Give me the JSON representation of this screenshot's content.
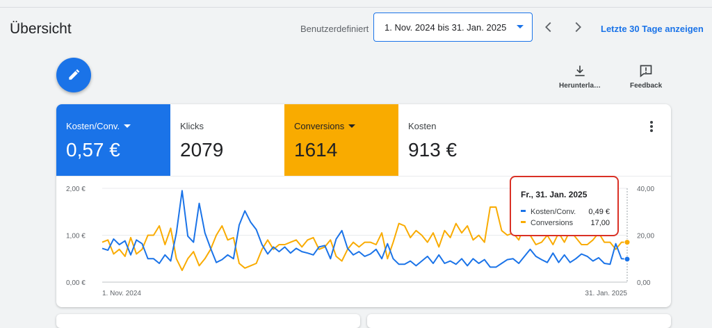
{
  "page": {
    "title": "Übersicht"
  },
  "date_range": {
    "label": "Benutzerdefiniert",
    "value": "1. Nov. 2024 bis 31. Jan. 2025",
    "prev_icon": "chevron-left-icon",
    "next_icon": "chevron-right-icon",
    "last_days_link": "Letzte 30 Tage anzeigen"
  },
  "toolbar": {
    "edit_icon": "pencil-icon",
    "download_label": "Herunterla…",
    "feedback_label": "Feedback"
  },
  "metrics": [
    {
      "name": "Kosten/Conv.",
      "value": "0,57 €",
      "selected": true,
      "color": "#1a73e8"
    },
    {
      "name": "Klicks",
      "value": "2079",
      "selected": false
    },
    {
      "name": "Conversions",
      "value": "1614",
      "selected": true,
      "color": "#f9ab00"
    },
    {
      "name": "Kosten",
      "value": "913 €",
      "selected": false
    }
  ],
  "tooltip": {
    "title": "Fr., 31. Jan. 2025",
    "rows": [
      {
        "label": "Kosten/Conv.",
        "value": "0,49 €",
        "color": "#1a73e8"
      },
      {
        "label": "Conversions",
        "value": "17,00",
        "color": "#f9ab00"
      }
    ]
  },
  "chart_data": {
    "type": "line",
    "x_start_label": "1. Nov. 2024",
    "x_end_label": "31. Jan. 2025",
    "y_left": {
      "ticks": [
        "0,00 €",
        "1,00 €",
        "2,00 €"
      ],
      "range": [
        0,
        2
      ]
    },
    "y_right": {
      "ticks": [
        "0,00",
        "20,00",
        "40,00"
      ],
      "range": [
        0,
        40
      ]
    },
    "grid": true,
    "series": [
      {
        "name": "Kosten/Conv.",
        "axis": "left",
        "color": "#1a73e8",
        "values": [
          0.72,
          0.68,
          0.92,
          0.8,
          0.88,
          0.58,
          0.9,
          0.82,
          0.5,
          0.5,
          0.4,
          0.58,
          0.45,
          1.05,
          1.95,
          0.98,
          0.85,
          1.68,
          1.05,
          0.72,
          0.42,
          0.48,
          0.58,
          0.5,
          1.22,
          1.52,
          1.28,
          1.12,
          0.8,
          0.6,
          0.75,
          0.65,
          0.75,
          0.62,
          0.72,
          0.65,
          0.62,
          0.58,
          0.75,
          0.78,
          0.5,
          0.92,
          1.1,
          0.72,
          0.58,
          0.65,
          0.55,
          0.6,
          0.7,
          0.5,
          0.82,
          0.5,
          0.38,
          0.38,
          0.45,
          0.35,
          0.45,
          0.55,
          0.4,
          0.58,
          0.4,
          0.45,
          0.38,
          0.5,
          0.35,
          0.5,
          0.4,
          0.48,
          0.32,
          0.32,
          0.4,
          0.48,
          0.5,
          0.4,
          0.55,
          0.7,
          0.55,
          0.48,
          0.42,
          0.62,
          0.42,
          0.58,
          0.42,
          0.5,
          0.6,
          0.55,
          0.45,
          0.52,
          0.4,
          0.38,
          0.82,
          0.5,
          0.49
        ]
      },
      {
        "name": "Conversions",
        "axis": "right",
        "color": "#f9ab00",
        "values": [
          17,
          18,
          12,
          14,
          11,
          19,
          12,
          14,
          20,
          20,
          24,
          16,
          23,
          10,
          5,
          10,
          13,
          7,
          10,
          14,
          20,
          24,
          18,
          19,
          8,
          6,
          7,
          8,
          14,
          18,
          14,
          16,
          16,
          17,
          18,
          15,
          18,
          19,
          14,
          15,
          18,
          11,
          9,
          14,
          17,
          15,
          17,
          17,
          16,
          21,
          10,
          17,
          25,
          24,
          19,
          22,
          20,
          17,
          21,
          15,
          22,
          19,
          25,
          21,
          24,
          18,
          20,
          17,
          32,
          32,
          22,
          20,
          21,
          18,
          24,
          20,
          16,
          17,
          20,
          16,
          21,
          17,
          22,
          19,
          16,
          16,
          18,
          21,
          17,
          17,
          14,
          17,
          17
        ]
      }
    ]
  }
}
